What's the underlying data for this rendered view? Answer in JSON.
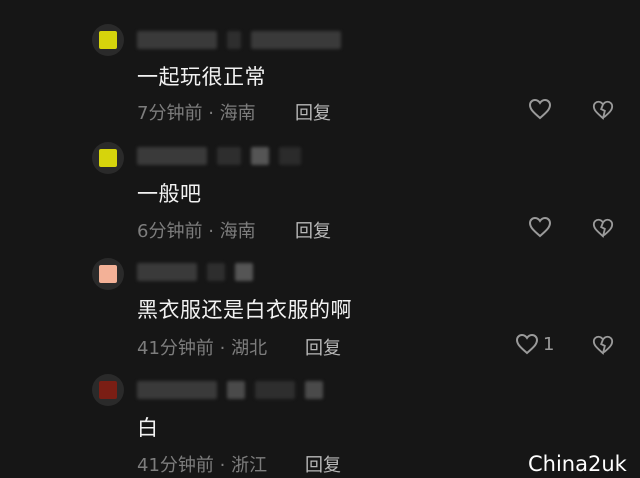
{
  "comments": [
    {
      "avatar_color": "#d6d40c",
      "text": "一起玩很正常",
      "time": "7分钟前",
      "location": "海南",
      "reply_label": "回复",
      "like_count": ""
    },
    {
      "avatar_color": "#d6d40c",
      "text": "一般吧",
      "time": "6分钟前",
      "location": "海南",
      "reply_label": "回复",
      "like_count": ""
    },
    {
      "avatar_color": "#f3b197",
      "text": "黑衣服还是白衣服的啊",
      "time": "41分钟前",
      "location": "湖北",
      "reply_label": "回复",
      "like_count": "1"
    },
    {
      "avatar_color": "#7a1e14",
      "text": "白",
      "time": "41分钟前",
      "location": "浙江",
      "reply_label": "回复",
      "like_count": ""
    }
  ],
  "separator": "·",
  "watermark": "China2uk",
  "icons": {
    "like": "heart-outline-icon",
    "dislike": "broken-heart-icon"
  }
}
